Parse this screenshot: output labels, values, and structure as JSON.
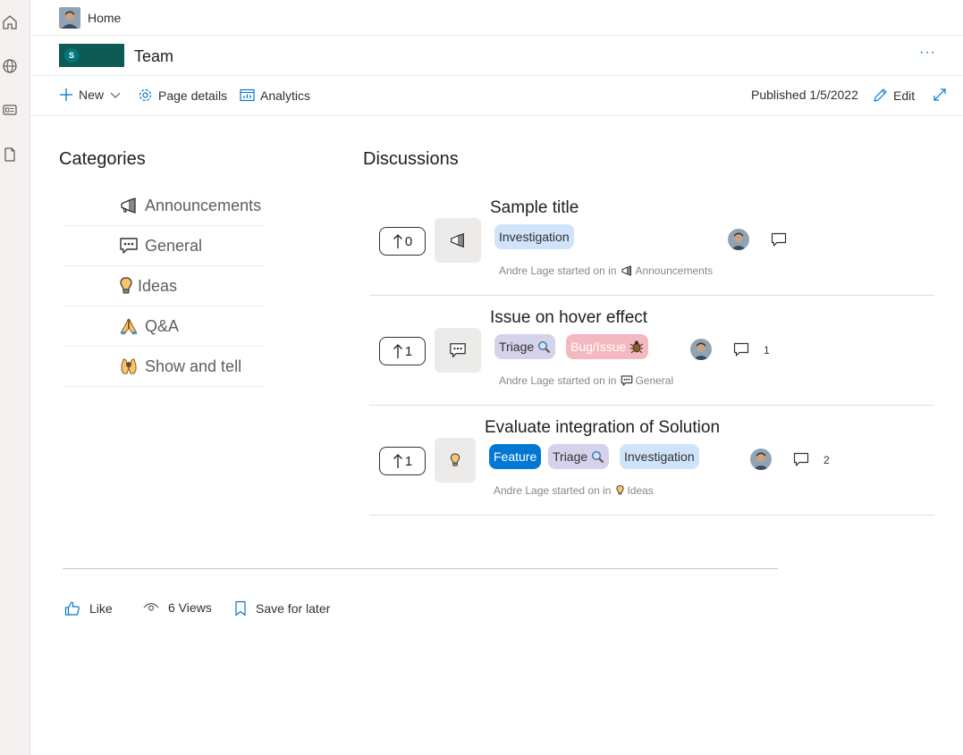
{
  "nav": {
    "home_label": "Home",
    "site_title": "Team",
    "site_logo_letter": "S",
    "more_label": "···"
  },
  "commands": {
    "new_label": "New",
    "page_details_label": "Page details",
    "analytics_label": "Analytics",
    "published_label": "Published 1/5/2022",
    "edit_label": "Edit"
  },
  "categories": {
    "heading": "Categories",
    "items": [
      {
        "label": "Announcements",
        "icon": "megaphone-icon"
      },
      {
        "label": "General",
        "icon": "speech-bubble-icon"
      },
      {
        "label": "Ideas",
        "icon": "lightbulb-icon"
      },
      {
        "label": "Q&A",
        "icon": "folded-hands-icon"
      },
      {
        "label": "Show and tell",
        "icon": "raised-hands-icon"
      }
    ]
  },
  "discussions": {
    "heading": "Discussions",
    "items": [
      {
        "votes": "0",
        "title": "Sample title",
        "tags": [
          "Investigation"
        ],
        "meta_prefix": "Andre Lage started on in",
        "category": "Announcements",
        "comments": ""
      },
      {
        "votes": "1",
        "title": "Issue on hover effect",
        "tags": [
          "Triage",
          "Bug/Issue"
        ],
        "meta_prefix": "Andre Lage started on in",
        "category": "General",
        "comments": "1"
      },
      {
        "votes": "1",
        "title": "Evaluate integration of Solution",
        "tags": [
          "Feature",
          "Triage",
          "Investigation"
        ],
        "meta_prefix": "Andre Lage started on in",
        "category": "Ideas",
        "comments": "2"
      }
    ]
  },
  "footer": {
    "like_label": "Like",
    "views_label": "6 Views",
    "save_label": "Save for later"
  },
  "colors": {
    "accent": "#0078d4",
    "site_logo_bg": "#0e5a55",
    "tag_blue": "#cfe4fa",
    "tag_lavender": "#d5d3eb",
    "tag_pink": "#f4b8c0",
    "tag_feature": "#0078d4"
  }
}
